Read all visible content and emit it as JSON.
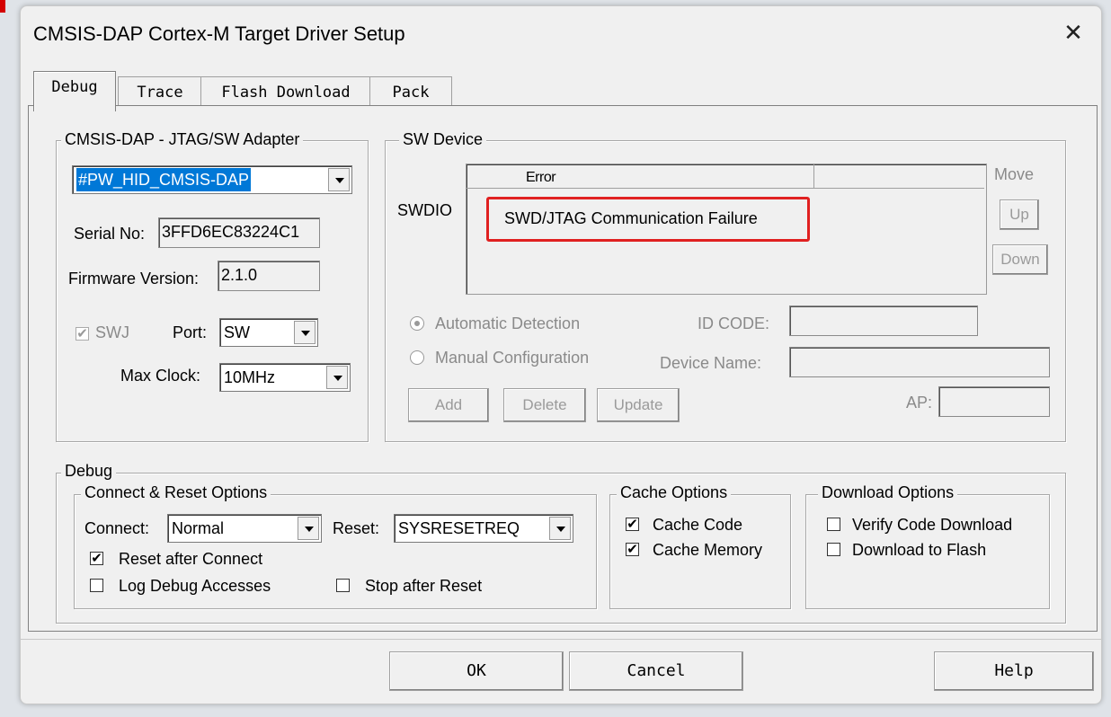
{
  "dialog": {
    "title": "CMSIS-DAP Cortex-M Target Driver Setup"
  },
  "tabs": [
    "Debug",
    "Trace",
    "Flash Download",
    "Pack"
  ],
  "adapter": {
    "legend": "CMSIS-DAP - JTAG/SW Adapter",
    "selected": "#PW_HID_CMSIS-DAP",
    "serial_label": "Serial No:",
    "serial_value": "3FFD6EC83224C1",
    "firmware_label": "Firmware Version:",
    "firmware_value": "2.1.0",
    "swj_label": "SWJ",
    "port_label": "Port:",
    "port_value": "SW",
    "clock_label": "Max Clock:",
    "clock_value": "10MHz"
  },
  "sw_device": {
    "legend": "SW Device",
    "swdio_label": "SWDIO",
    "column_header": "Error",
    "error_message": "SWD/JTAG Communication Failure",
    "move_label": "Move",
    "up_label": "Up",
    "down_label": "Down",
    "auto_detect": "Automatic Detection",
    "manual_config": "Manual Configuration",
    "id_code_label": "ID CODE:",
    "device_name_label": "Device Name:",
    "ap_label": "AP:",
    "add_label": "Add",
    "delete_label": "Delete",
    "update_label": "Update"
  },
  "debug": {
    "legend": "Debug",
    "connect_reset": {
      "legend": "Connect & Reset Options",
      "connect_label": "Connect:",
      "connect_value": "Normal",
      "reset_label": "Reset:",
      "reset_value": "SYSRESETREQ",
      "reset_after_connect": "Reset after Connect",
      "log_debug": "Log Debug Accesses",
      "stop_after_reset": "Stop after Reset"
    },
    "cache": {
      "legend": "Cache Options",
      "cache_code": "Cache Code",
      "cache_memory": "Cache Memory"
    },
    "download": {
      "legend": "Download Options",
      "verify": "Verify Code Download",
      "to_flash": "Download to Flash"
    }
  },
  "footer": {
    "ok": "OK",
    "cancel": "Cancel",
    "help": "Help"
  },
  "colors": {
    "highlight": "#0078d7",
    "error_box": "#e02020"
  }
}
